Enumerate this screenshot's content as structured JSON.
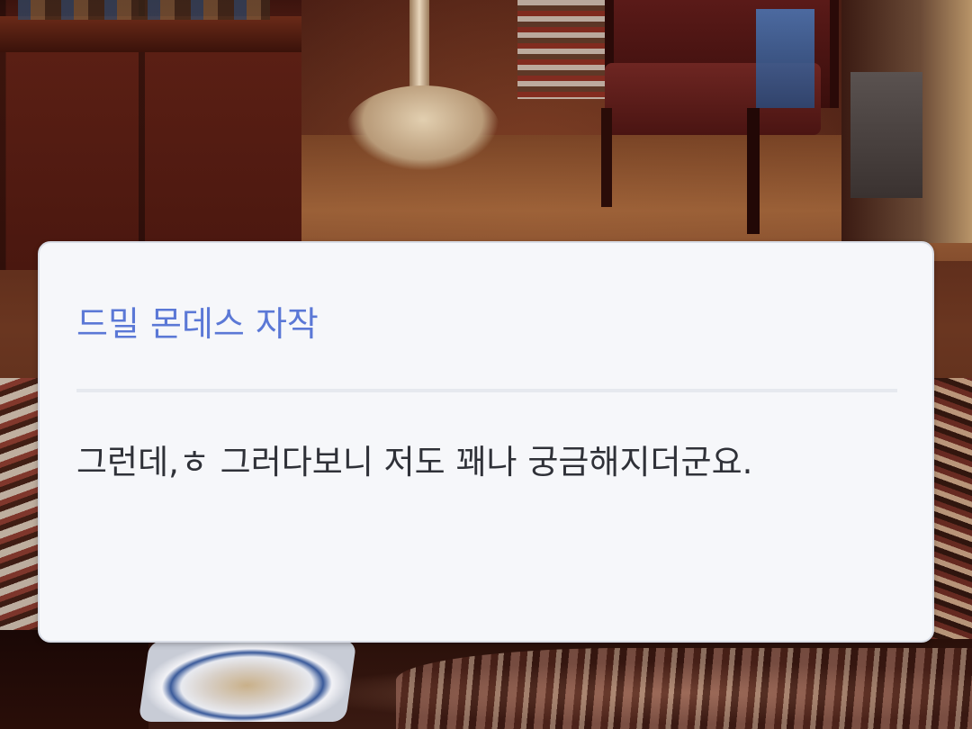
{
  "dialogue": {
    "speaker": "드밀 몬데스 자작",
    "text": "그런데,ㅎ 그러다보니 저도 꽤나 궁금해지더군요."
  },
  "colors": {
    "speaker_name": "#5b78d6",
    "dialogue_text": "#2f3138",
    "box_background": "#f6f7fa",
    "divider": "#e6e9ef"
  },
  "background": {
    "scene": "wood-paneled study interior"
  }
}
